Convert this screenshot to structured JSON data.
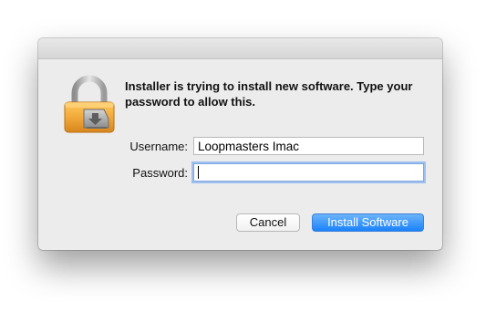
{
  "dialog": {
    "message": "Installer is trying to install new software. Type your password to allow this.",
    "username_label": "Username:",
    "username_value": "Loopmasters Imac",
    "password_label": "Password:",
    "password_value": "",
    "cancel_label": "Cancel",
    "confirm_label": "Install Software"
  },
  "icons": {
    "lock": "padlock-installer-icon"
  },
  "colors": {
    "dialog_bg": "#ececec",
    "primary_button": "#1a82fb",
    "focus_ring": "#9ec1f0",
    "lock_body": "#f2a93b"
  }
}
